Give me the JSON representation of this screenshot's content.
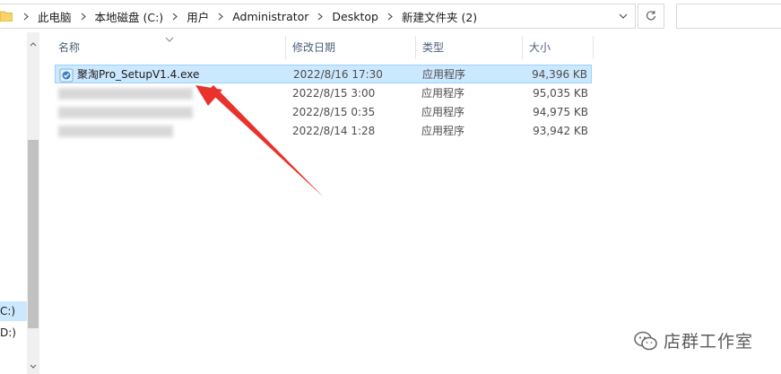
{
  "address_bar": {
    "breadcrumbs": [
      "此电脑",
      "本地磁盘 (C:)",
      "用户",
      "Administrator",
      "Desktop",
      "新建文件夹 (2)"
    ]
  },
  "nav": {
    "drives": [
      {
        "label": "C:)"
      },
      {
        "label": "D:)"
      }
    ]
  },
  "columns": {
    "name": "名称",
    "date": "修改日期",
    "type": "类型",
    "size": "大小"
  },
  "files": [
    {
      "name": "聚淘Pro_SetupV1.4.exe",
      "date": "2022/8/16 17:30",
      "type": "应用程序",
      "size": "94,396 KB",
      "selected": true
    },
    {
      "name": "",
      "date": "2022/8/15 3:00",
      "type": "应用程序",
      "size": "95,035 KB",
      "selected": false
    },
    {
      "name": "",
      "date": "2022/8/15 0:35",
      "type": "应用程序",
      "size": "94,975 KB",
      "selected": false
    },
    {
      "name": "",
      "date": "2022/8/14 1:28",
      "type": "应用程序",
      "size": "93,942 KB",
      "selected": false
    }
  ],
  "colors": {
    "selection": "#cce8ff",
    "arrow": "#e8322b"
  },
  "watermark": {
    "text": "店群工作室",
    "icon": "wechat-icon"
  }
}
